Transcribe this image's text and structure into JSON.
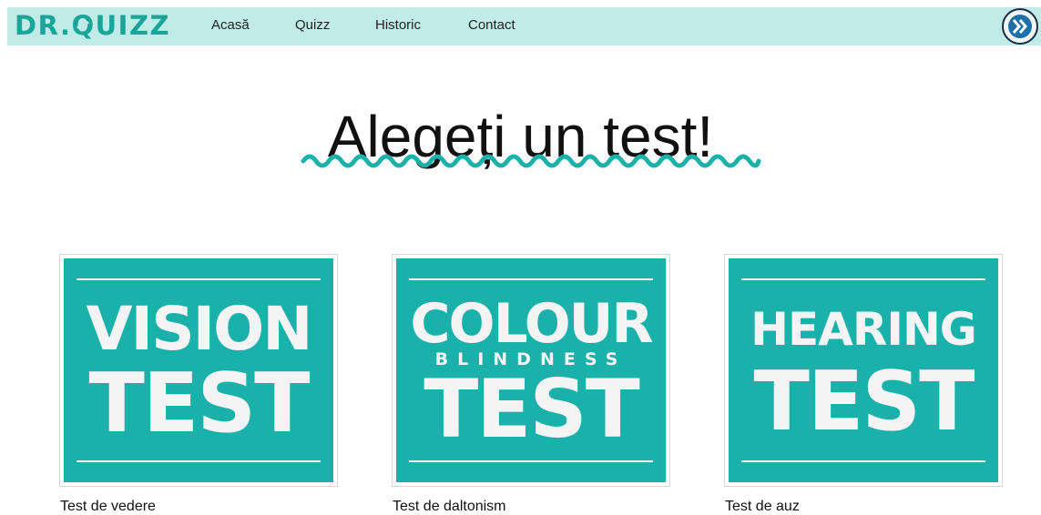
{
  "nav": {
    "logo": {
      "prefix": "DR.",
      "q": "Q",
      "suffix": "UIZZ"
    },
    "links": [
      "Acasă",
      "Quizz",
      "Historic",
      "Contact"
    ],
    "button_icon": "double-chevron-right-icon"
  },
  "main": {
    "title": "Alegeți un test!"
  },
  "tests": [
    {
      "art": {
        "line1": "VISION",
        "line2": "TEST"
      },
      "caption": "Test de vedere"
    },
    {
      "art": {
        "line1": "COLOUR",
        "middle": "BLINDNESS",
        "line2": "TEST"
      },
      "caption": "Test de daltonism"
    },
    {
      "art": {
        "line1": "HEARING",
        "line2": "TEST"
      },
      "caption": "Test de auz"
    }
  ],
  "colors": {
    "navbar_bg": "#c1ebe6",
    "brand_teal": "#1aa49a",
    "card_teal": "#1ab1ab",
    "squiggle": "#1ab1ab"
  }
}
